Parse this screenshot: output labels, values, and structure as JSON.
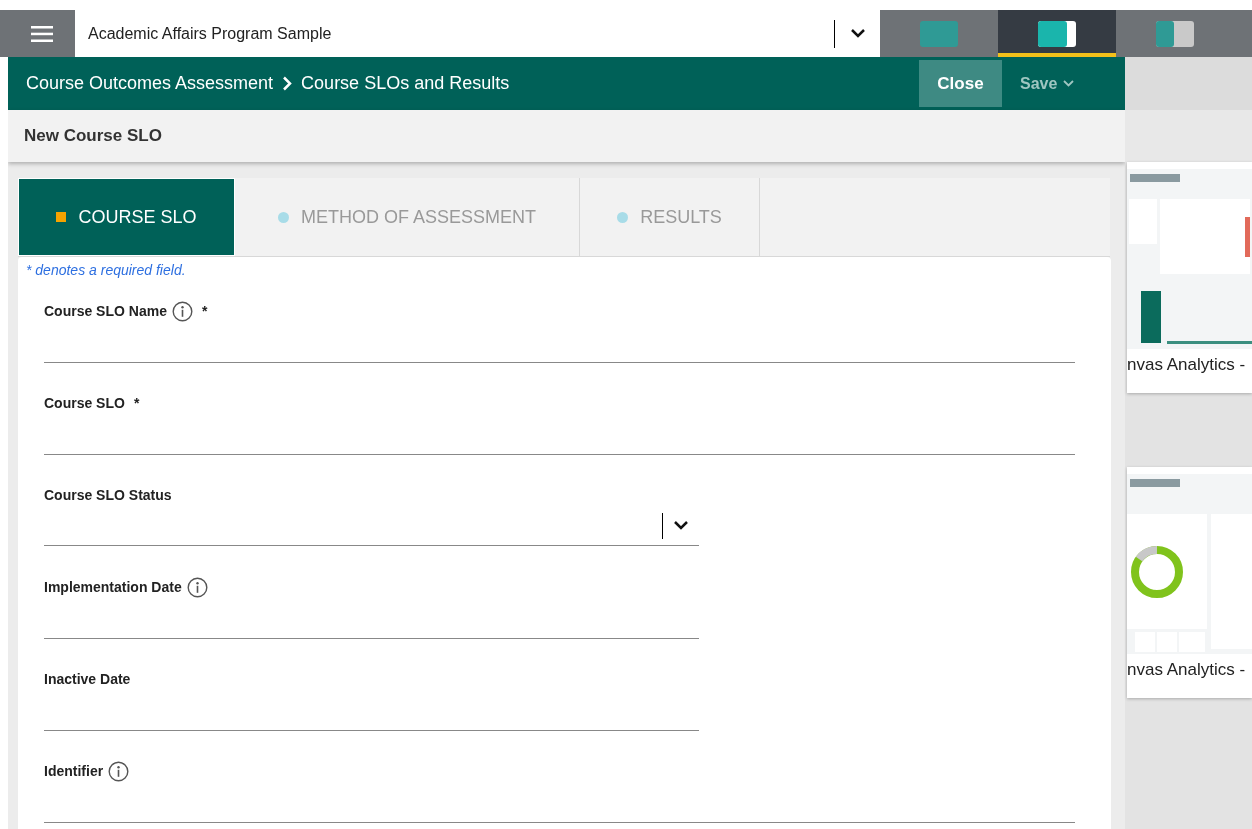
{
  "top_bar": {
    "title": "Academic Affairs Program Sample",
    "layout_buttons": [
      {
        "selected": false
      },
      {
        "selected": true
      },
      {
        "selected": false
      }
    ]
  },
  "header": {
    "breadcrumb": [
      "Course Outcomes Assessment",
      "Course SLOs and Results"
    ],
    "close_button": "Close",
    "save_button": "Save"
  },
  "page_title": "New Course SLO",
  "tabs": [
    {
      "label": "COURSE SLO",
      "selected": true
    },
    {
      "label": "METHOD OF ASSESSMENT",
      "selected": false
    },
    {
      "label": "RESULTS",
      "selected": false
    }
  ],
  "required_note": "* denotes a required field.",
  "fields": [
    {
      "label": "Course SLO Name",
      "info": true,
      "required_mark": "*",
      "kind": "wide"
    },
    {
      "label": "Course SLO",
      "info": false,
      "required_mark": "*",
      "kind": "wide"
    },
    {
      "label": "Course SLO Status",
      "info": false,
      "kind": "select"
    },
    {
      "label": "Implementation Date",
      "info": true,
      "kind": "narrow"
    },
    {
      "label": "Inactive Date",
      "info": false,
      "kind": "narrow"
    },
    {
      "label": "Identifier",
      "info": true,
      "kind": "wide"
    }
  ],
  "side_cards": [
    {
      "caption": "nvas Analytics -",
      "kind": "bars"
    },
    {
      "caption": "nvas Analytics -",
      "kind": "donut"
    }
  ]
}
